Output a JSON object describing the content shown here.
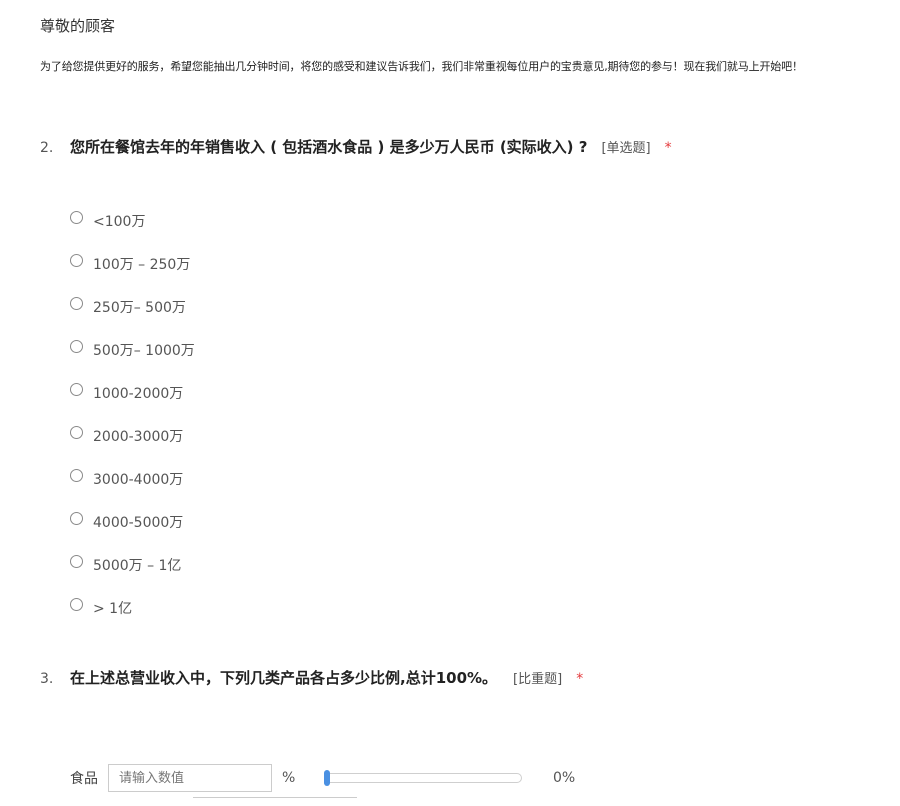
{
  "header": {
    "greeting": "尊敬的顾客",
    "intro": "为了给您提供更好的服务，希望您能抽出几分钟时间，将您的感受和建议告诉我们，我们非常重视每位用户的宝贵意见,期待您的参与！现在我们就马上开始吧！"
  },
  "q2": {
    "number": "2.",
    "title": "您所在餐馆去年的年销售收入 ( 包括酒水食品 ) 是多少万人民币 (实际收入) ?",
    "type_tag": "[单选题]",
    "required_mark": "*",
    "options": [
      "<100万",
      "100万 – 250万",
      "250万– 500万",
      "500万– 1000万",
      "1000-2000万",
      "2000-3000万",
      "3000-4000万",
      "4000-5000万",
      "5000万 – 1亿",
      "> 1亿"
    ]
  },
  "q3": {
    "number": "3.",
    "title": "在上述总营业收入中，下列几类产品各占多少比例,总计100%。",
    "type_tag": "[比重题]",
    "required_mark": "*",
    "rows": [
      {
        "label": "食品",
        "placeholder": "请输入数值",
        "unit": "%",
        "value_text": "0%",
        "slider_fraction": 0
      }
    ]
  },
  "colors": {
    "accent": "#4a90e2",
    "required": "#e4393c"
  }
}
